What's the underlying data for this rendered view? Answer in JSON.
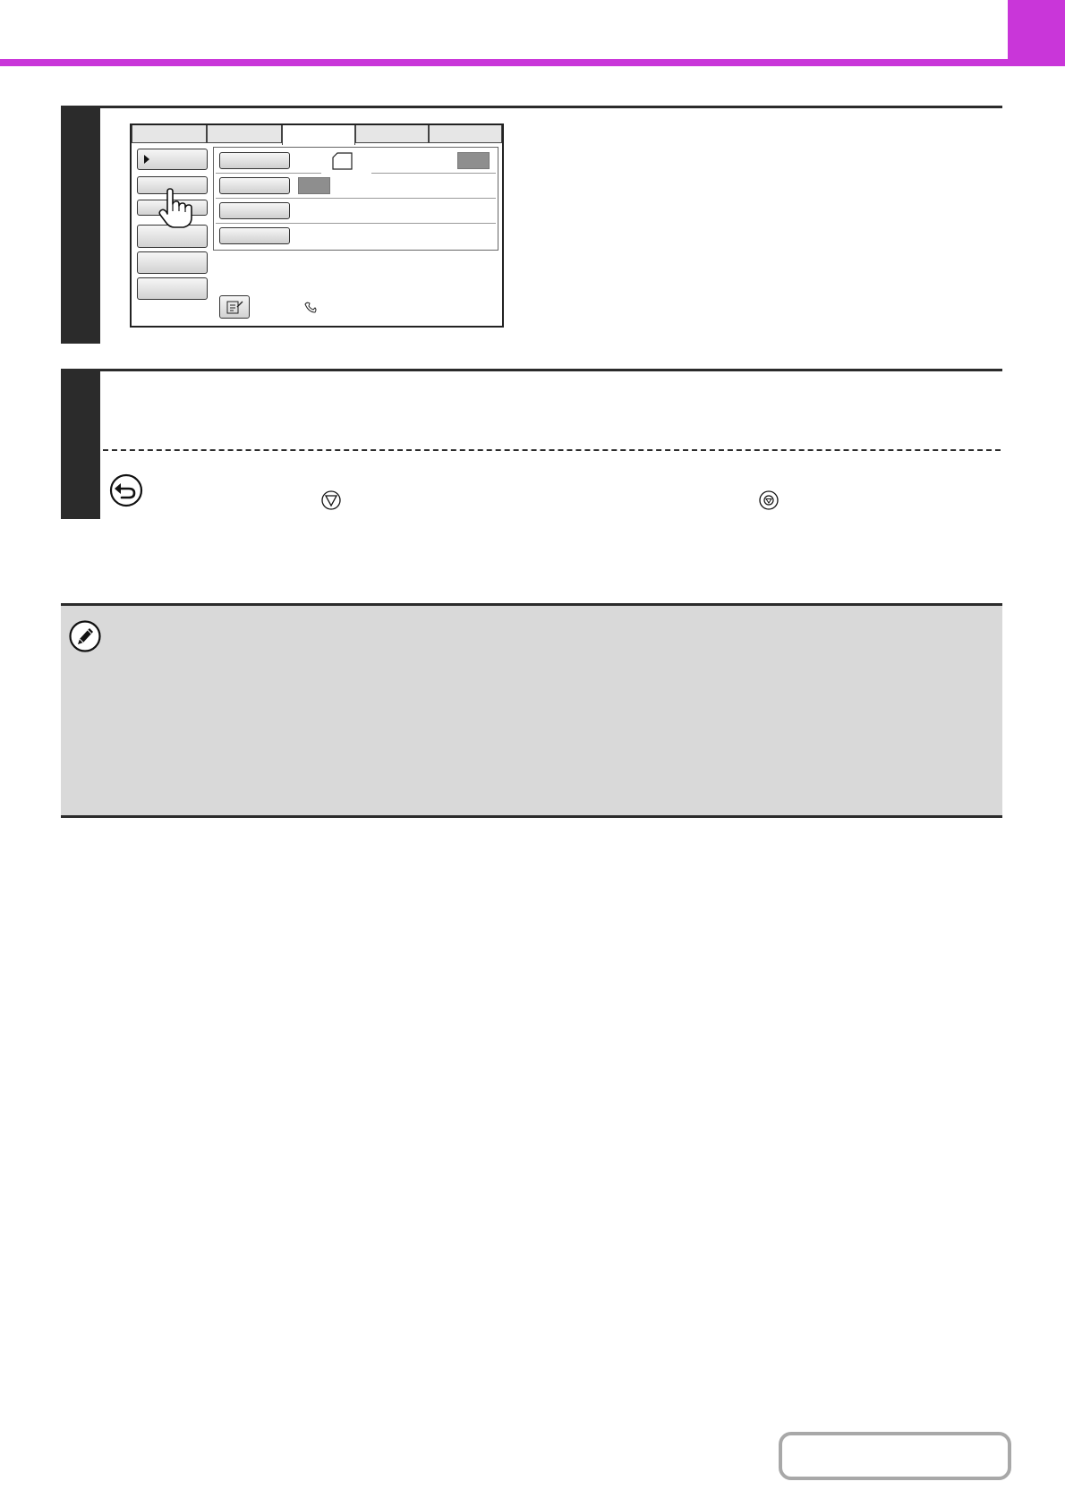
{
  "header": {
    "accent_color": "#c936d9"
  },
  "steps": [
    {
      "id": "step-1",
      "has_panel_screenshot": true
    },
    {
      "id": "step-2",
      "has_dashed_separator": true
    }
  ],
  "panel": {
    "tab_count": 5,
    "active_tab_index": 2,
    "left_button_count": 6,
    "settings_row_count": 4
  },
  "icons": {
    "return": "return-arrow-icon",
    "stop": "stop-key-icon",
    "clear_all": "clear-all-key-icon",
    "note": "pencil-note-icon",
    "pointer": "pointing-hand-icon"
  },
  "colors": {
    "step_bar": "#2b2b2b",
    "note_bg": "#d9d9d9"
  }
}
